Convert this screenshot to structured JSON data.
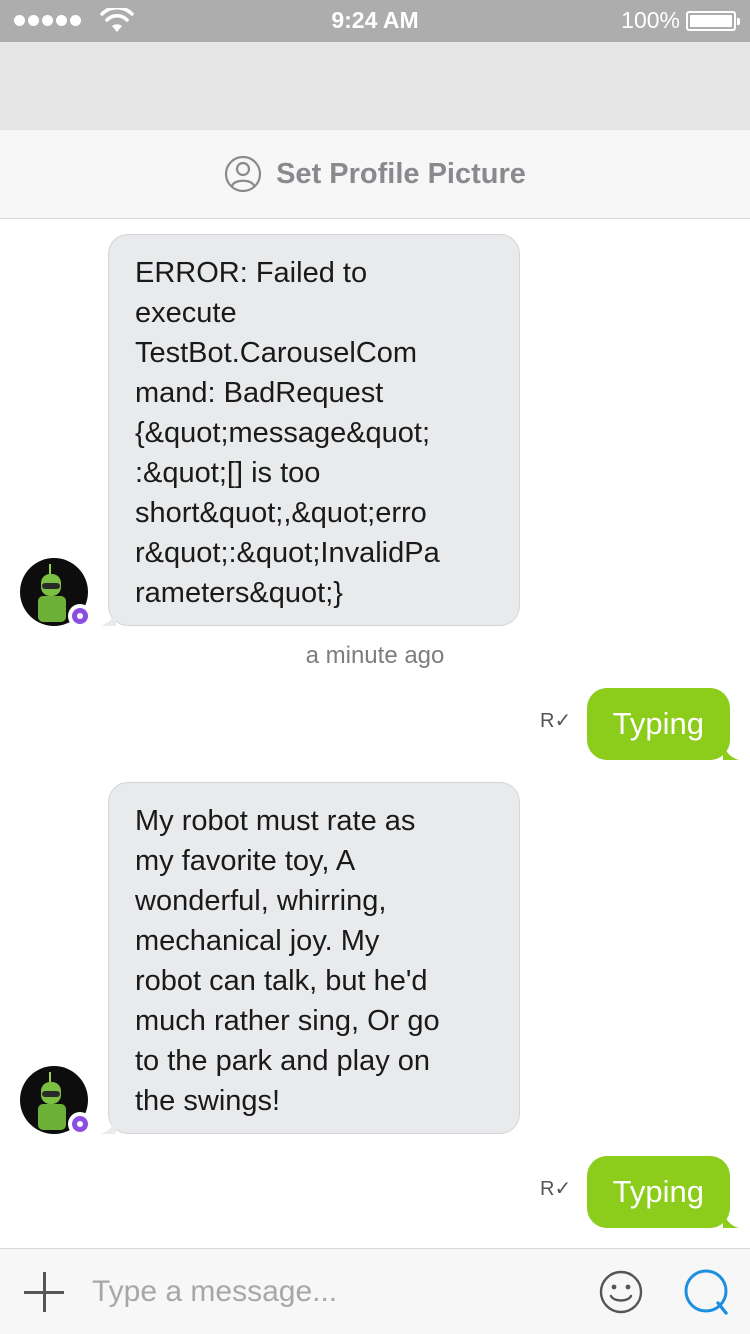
{
  "status_bar": {
    "time": "9:24 AM",
    "battery_percent": "100%",
    "signal_bars": 5
  },
  "profile_header": {
    "label": "Set Profile Picture",
    "icon": "user-circle-icon"
  },
  "messages": [
    {
      "direction": "incoming",
      "text": "ERROR: Failed to execute TestBot.CarouselCommand: BadRequest {&quot;message&quot;:&quot;[] is too short&quot;,&quot;error&quot;:&quot;InvalidParameters&quot;}",
      "lines": [
        "ERROR: Failed to",
        "execute",
        "TestBot.CarouselCom",
        "mand: BadRequest",
        "{&quot;message&quot;",
        ":&quot;[] is too",
        "short&quot;,&quot;erro",
        "r&quot;:&quot;InvalidPa",
        "rameters&quot;}"
      ]
    },
    {
      "direction": "outgoing",
      "text": "Typing",
      "receipt": "R✓"
    },
    {
      "direction": "incoming",
      "text": "My robot must rate as my favorite toy,  A wonderful, whirring, mechanical joy.  My robot can talk, but he'd much rather sing,  Or go to the park and play on the swings!",
      "lines": [
        "My robot must rate as",
        "my favorite toy,  A",
        "wonderful, whirring,",
        "mechanical joy.  My",
        "robot can talk, but he'd",
        "much rather sing,  Or go",
        "to the park and play on",
        "the swings!"
      ]
    },
    {
      "direction": "outgoing",
      "text": "Typing",
      "receipt": "R✓"
    }
  ],
  "timestamp": "a minute ago",
  "composer": {
    "placeholder": "Type a message...",
    "value": ""
  },
  "colors": {
    "outgoing_bubble": "#8ccc1a",
    "incoming_bubble": "#e9eaec",
    "send_icon": "#1e8fe0",
    "badge": "#8a4fe0"
  }
}
